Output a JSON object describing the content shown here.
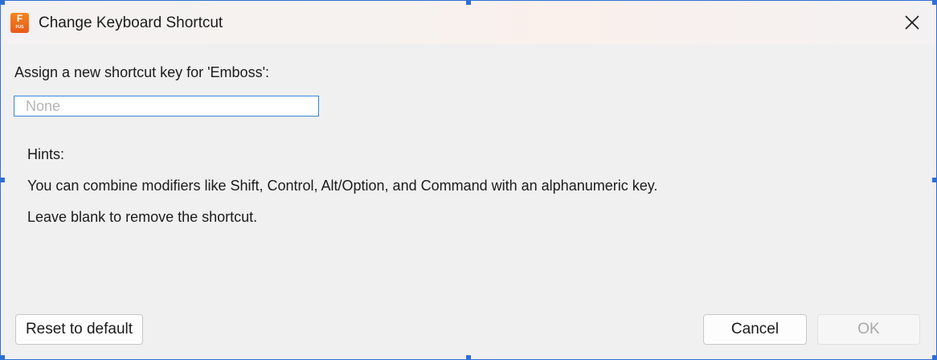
{
  "window": {
    "title": "Change Keyboard Shortcut",
    "app_icon": {
      "name": "fusion-app-icon",
      "letter": "F",
      "sub": "FUS",
      "color": "#f07a1f"
    },
    "close_icon": "close-icon"
  },
  "form": {
    "assign_label": "Assign a new shortcut key for 'Emboss':",
    "shortcut_input": {
      "value": "",
      "placeholder": "None"
    }
  },
  "hints": {
    "title": "Hints:",
    "line1": "You can combine modifiers like Shift, Control, Alt/Option, and Command with an alphanumeric key.",
    "line2": "Leave blank to remove the shortcut."
  },
  "buttons": {
    "reset_label": "Reset to default",
    "cancel_label": "Cancel",
    "ok_label": "OK",
    "ok_enabled": false
  },
  "colors": {
    "accent": "#2f6fd6",
    "input_focus_border": "#3b87d6",
    "dialog_bg": "#f0f0f0",
    "disabled_text": "#a8a8a8"
  }
}
